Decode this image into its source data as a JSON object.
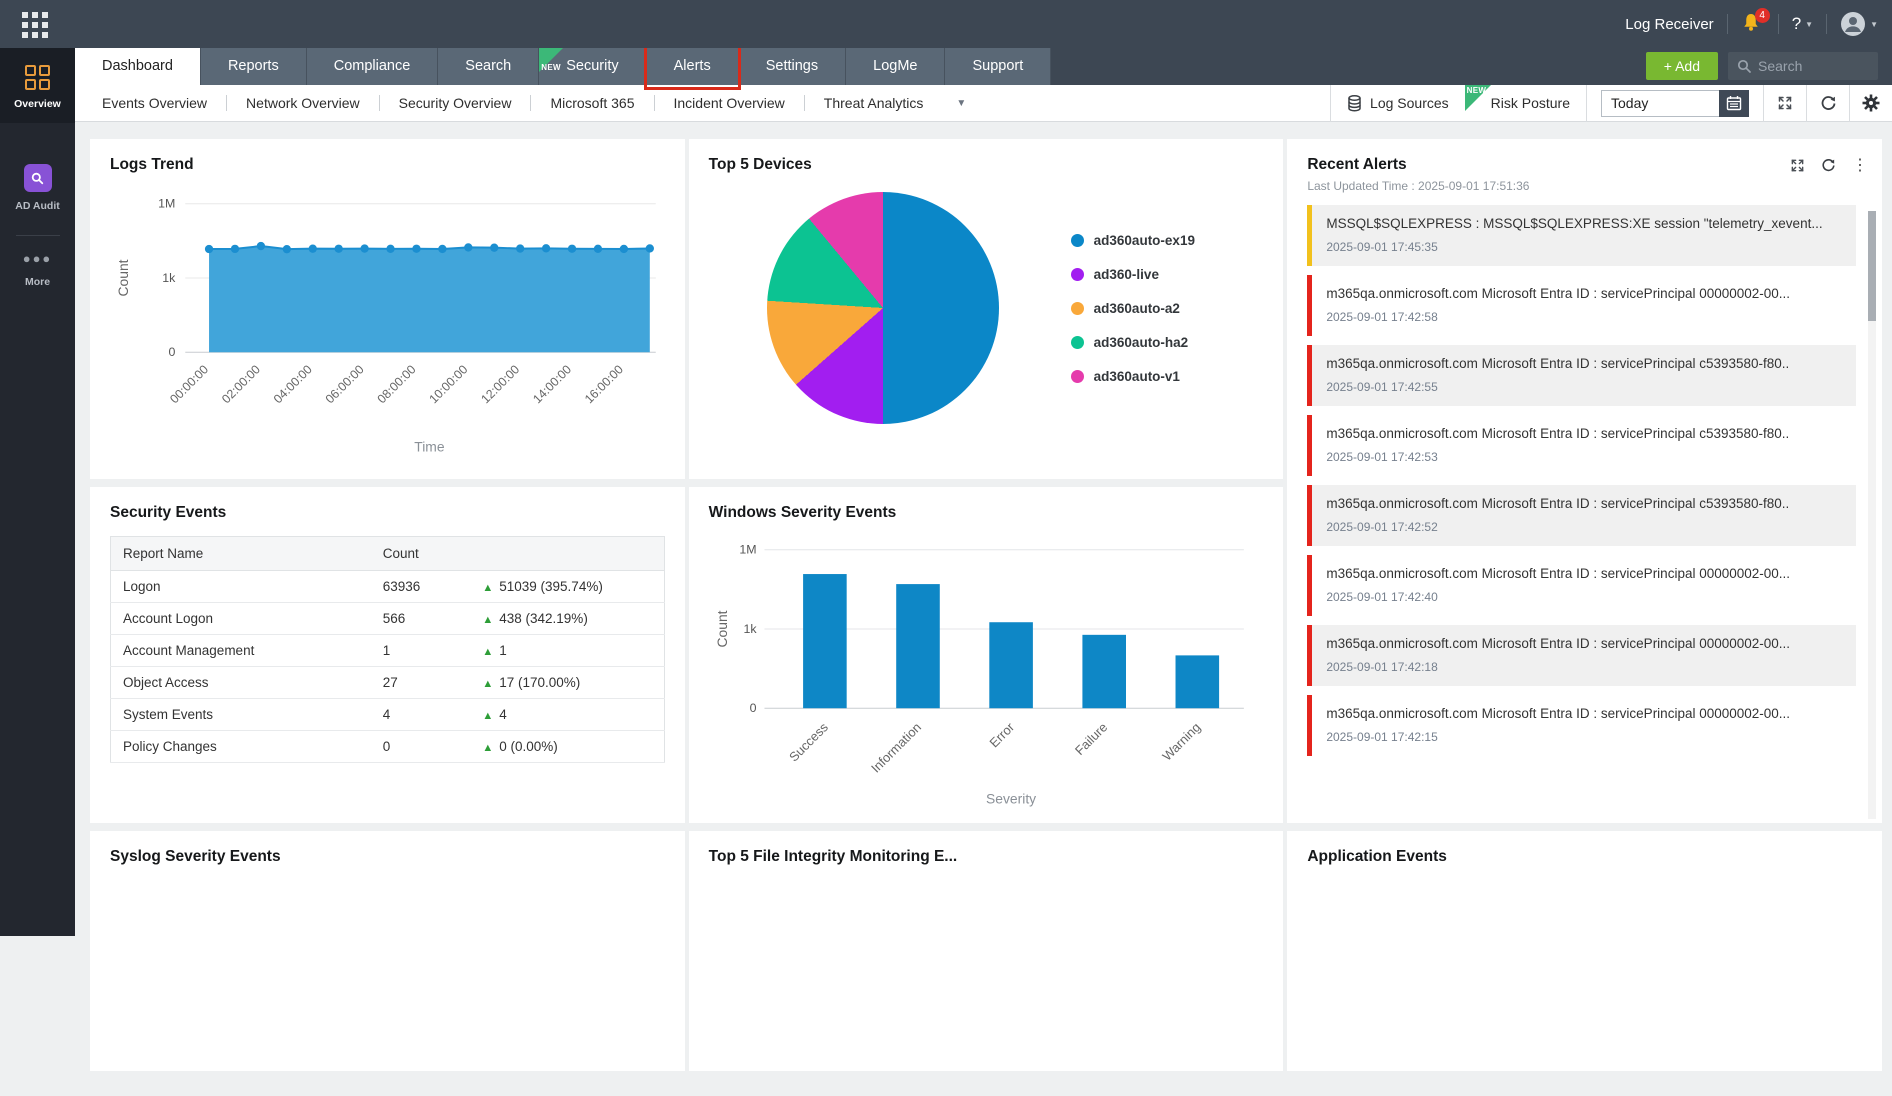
{
  "topbar": {
    "log_receiver_label": "Log Receiver",
    "notification_count": "4",
    "help_label": "?"
  },
  "nav": {
    "tabs": [
      {
        "label": "Dashboard",
        "active": true
      },
      {
        "label": "Reports"
      },
      {
        "label": "Compliance"
      },
      {
        "label": "Search"
      },
      {
        "label": "Security",
        "badge": "NEW"
      },
      {
        "label": "Alerts",
        "highlighted": true
      },
      {
        "label": "Settings"
      },
      {
        "label": "LogMe"
      },
      {
        "label": "Support"
      }
    ],
    "add_label": "+ Add",
    "search_placeholder": "Search"
  },
  "subnav": {
    "tabs": [
      "Events Overview",
      "Network Overview",
      "Security Overview",
      "Microsoft 365",
      "Incident Overview",
      "Threat Analytics"
    ],
    "log_sources": "Log Sources",
    "risk_posture": "Risk Posture",
    "risk_posture_badge": "NEW",
    "date_range": "Today"
  },
  "sidebar": {
    "items": [
      {
        "label": "Overview",
        "active": true
      },
      {
        "label": "AD Audit"
      },
      {
        "label": "More"
      }
    ]
  },
  "panels": {
    "logs_trend": {
      "title": "Logs Trend"
    },
    "top_devices": {
      "title": "Top 5 Devices"
    },
    "windows_severity": {
      "title": "Windows Severity Events"
    },
    "security_events": {
      "title": "Security Events",
      "columns": [
        "Report Name",
        "Count"
      ],
      "rows": [
        {
          "name": "Logon",
          "count": "63936",
          "delta": "51039 (395.74%)"
        },
        {
          "name": "Account Logon",
          "count": "566",
          "delta": "438 (342.19%)"
        },
        {
          "name": "Account Management",
          "count": "1",
          "delta": "1"
        },
        {
          "name": "Object Access",
          "count": "27",
          "delta": "17 (170.00%)"
        },
        {
          "name": "System Events",
          "count": "4",
          "delta": "4"
        },
        {
          "name": "Policy Changes",
          "count": "0",
          "delta": "0 (0.00%)"
        }
      ]
    },
    "recent_alerts": {
      "title": "Recent Alerts",
      "last_updated": "Last Updated Time : 2025-09-01 17:51:36",
      "items": [
        {
          "text": "MSSQL$SQLEXPRESS : MSSQL$SQLEXPRESS:XE session \"telemetry_xevent...",
          "time": "2025-09-01 17:45:35",
          "severity": "yellow"
        },
        {
          "text": "m365qa.onmicrosoft.com Microsoft Entra ID : servicePrincipal 00000002-00...",
          "time": "2025-09-01 17:42:58",
          "severity": "red"
        },
        {
          "text": "m365qa.onmicrosoft.com Microsoft Entra ID : servicePrincipal c5393580-f80..",
          "time": "2025-09-01 17:42:55",
          "severity": "red"
        },
        {
          "text": "m365qa.onmicrosoft.com Microsoft Entra ID : servicePrincipal c5393580-f80..",
          "time": "2025-09-01 17:42:53",
          "severity": "red"
        },
        {
          "text": "m365qa.onmicrosoft.com Microsoft Entra ID : servicePrincipal c5393580-f80..",
          "time": "2025-09-01 17:42:52",
          "severity": "red"
        },
        {
          "text": "m365qa.onmicrosoft.com Microsoft Entra ID : servicePrincipal 00000002-00...",
          "time": "2025-09-01 17:42:40",
          "severity": "red"
        },
        {
          "text": "m365qa.onmicrosoft.com Microsoft Entra ID : servicePrincipal 00000002-00...",
          "time": "2025-09-01 17:42:18",
          "severity": "red"
        },
        {
          "text": "m365qa.onmicrosoft.com Microsoft Entra ID : servicePrincipal 00000002-00...",
          "time": "2025-09-01 17:42:15",
          "severity": "red"
        }
      ]
    },
    "syslog_severity": {
      "title": "Syslog Severity Events"
    },
    "fim": {
      "title": "Top 5 File Integrity Monitoring E..."
    },
    "application_events": {
      "title": "Application Events"
    }
  },
  "chart_data": [
    {
      "id": "logs_trend",
      "type": "area",
      "title": "Logs Trend",
      "xlabel": "Time",
      "ylabel": "Count",
      "scale": "log",
      "ylim": [
        0,
        1000000
      ],
      "yticks": [
        "1M",
        "1k",
        "0"
      ],
      "x": [
        "00:00:00",
        "01:00:00",
        "02:00:00",
        "03:00:00",
        "04:00:00",
        "05:00:00",
        "06:00:00",
        "07:00:00",
        "08:00:00",
        "09:00:00",
        "10:00:00",
        "11:00:00",
        "12:00:00",
        "13:00:00",
        "14:00:00",
        "15:00:00",
        "16:00:00",
        "17:00:00"
      ],
      "x_tick_labels": [
        "00:00:00",
        "02:00:00",
        "04:00:00",
        "06:00:00",
        "08:00:00",
        "10:00:00",
        "12:00:00",
        "14:00:00",
        "16:00:00"
      ],
      "values": [
        14800,
        15000,
        19500,
        14600,
        15300,
        15200,
        15400,
        15100,
        15200,
        14900,
        17200,
        16800,
        15400,
        15800,
        15200,
        15100,
        14900,
        15600
      ],
      "color": "#1b8ed0",
      "fill": "#41a5da"
    },
    {
      "id": "top_devices",
      "type": "pie",
      "title": "Top 5 Devices",
      "legend_position": "right",
      "slices": [
        {
          "label": "ad360auto-ex19",
          "pct": 50,
          "color": "#0b87c8"
        },
        {
          "label": "ad360-live",
          "pct": 13.5,
          "color": "#a21ef0"
        },
        {
          "label": "ad360auto-a2",
          "pct": 12.5,
          "color": "#f9a83a"
        },
        {
          "label": "ad360auto-ha2",
          "pct": 13,
          "color": "#0cc392"
        },
        {
          "label": "ad360auto-v1",
          "pct": 11,
          "color": "#e53bac"
        }
      ]
    },
    {
      "id": "windows_severity",
      "type": "bar",
      "title": "Windows Severity Events",
      "xlabel": "Severity",
      "ylabel": "Count",
      "scale": "log",
      "ylim": [
        0,
        1000000
      ],
      "yticks": [
        "1M",
        "1k",
        "0"
      ],
      "categories": [
        "Success",
        "Information",
        "Error",
        "Failure",
        "Warning"
      ],
      "values": [
        120000,
        50000,
        1800,
        600,
        100
      ],
      "color": "#0e87c6"
    }
  ],
  "colors": {
    "topbar_bg": "#3d4753",
    "tab_bg": "#5a6876",
    "add_green": "#79b831",
    "ribbon_green": "#3cb878",
    "highlight_red": "#d92a1a",
    "alert_red": "#e4241c",
    "alert_yellow": "#f2c11c",
    "chart_blue": "#0e87c6",
    "sidebar_orange": "#e89b3c",
    "ad_audit_purple": "#8852d6"
  }
}
